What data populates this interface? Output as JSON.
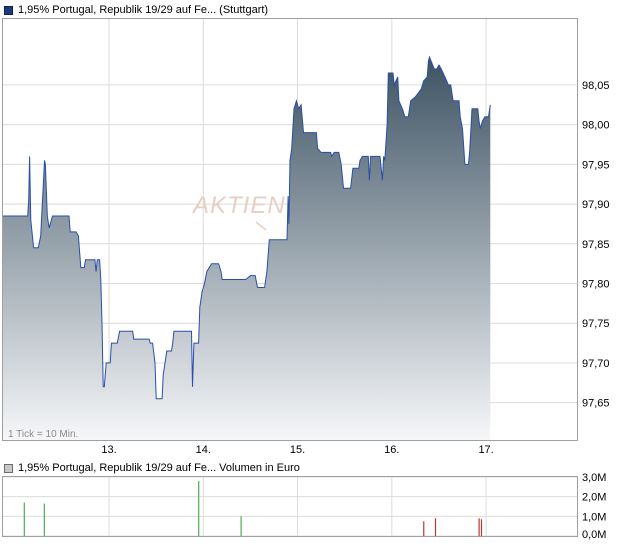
{
  "price_legend": {
    "label": "1,95% Portugal, Republik 19/29 auf Fe... (Stuttgart)"
  },
  "volume_legend": {
    "label": "1,95% Portugal, Republik 19/29 auf Fe... Volumen in Euro"
  },
  "tick_note": "1 Tick = 10 Min.",
  "watermark": "AKTIEN",
  "colors": {
    "line": "#2a4fa8",
    "area_top": "#3d5363",
    "area_bottom": "#f6f7f9",
    "grid": "#dcdcdc",
    "frame": "#a0a0a0",
    "volume_up": "#4caf50",
    "volume_down": "#c0392b"
  },
  "chart_data": [
    {
      "type": "area",
      "name": "price",
      "x_ticks": [
        {
          "label": "13.",
          "x": 4.5
        },
        {
          "label": "14.",
          "x": 8.5
        },
        {
          "label": "15.",
          "x": 12.5
        },
        {
          "label": "16.",
          "x": 16.5
        },
        {
          "label": "17.",
          "x": 20.5
        }
      ],
      "xlim": [
        0,
        24.4
      ],
      "ylim": [
        97.603,
        98.133
      ],
      "y_ticks": [
        {
          "label": "97,65",
          "value": 97.65
        },
        {
          "label": "97,70",
          "value": 97.7
        },
        {
          "label": "97,75",
          "value": 97.75
        },
        {
          "label": "97,80",
          "value": 97.8
        },
        {
          "label": "97,85",
          "value": 97.85
        },
        {
          "label": "97,90",
          "value": 97.9
        },
        {
          "label": "97,95",
          "value": 97.95
        },
        {
          "label": "98,00",
          "value": 98.0
        },
        {
          "label": "98,05",
          "value": 98.05
        }
      ],
      "points": [
        [
          0.0,
          97.885
        ],
        [
          1.05,
          97.885
        ],
        [
          1.09,
          97.905
        ],
        [
          1.13,
          97.96
        ],
        [
          1.18,
          97.88
        ],
        [
          1.3,
          97.845
        ],
        [
          1.5,
          97.845
        ],
        [
          1.6,
          97.86
        ],
        [
          1.76,
          97.955
        ],
        [
          1.8,
          97.95
        ],
        [
          1.88,
          97.885
        ],
        [
          1.96,
          97.87
        ],
        [
          2.1,
          97.885
        ],
        [
          2.8,
          97.885
        ],
        [
          2.85,
          97.865
        ],
        [
          3.1,
          97.865
        ],
        [
          3.2,
          97.86
        ],
        [
          3.3,
          97.82
        ],
        [
          3.45,
          97.82
        ],
        [
          3.5,
          97.83
        ],
        [
          3.9,
          97.83
        ],
        [
          3.95,
          97.815
        ],
        [
          4.0,
          97.83
        ],
        [
          4.1,
          97.83
        ],
        [
          4.15,
          97.805
        ],
        [
          4.2,
          97.75
        ],
        [
          4.25,
          97.67
        ],
        [
          4.3,
          97.67
        ],
        [
          4.38,
          97.7
        ],
        [
          4.55,
          97.7
        ],
        [
          4.6,
          97.725
        ],
        [
          4.85,
          97.725
        ],
        [
          4.95,
          97.74
        ],
        [
          5.5,
          97.74
        ],
        [
          5.55,
          97.73
        ],
        [
          6.2,
          97.73
        ],
        [
          6.25,
          97.725
        ],
        [
          6.35,
          97.725
        ],
        [
          6.45,
          97.7
        ],
        [
          6.5,
          97.655
        ],
        [
          6.75,
          97.655
        ],
        [
          6.8,
          97.685
        ],
        [
          6.95,
          97.715
        ],
        [
          7.15,
          97.715
        ],
        [
          7.2,
          97.725
        ],
        [
          7.25,
          97.74
        ],
        [
          8.0,
          97.74
        ],
        [
          8.04,
          97.67
        ],
        [
          8.1,
          97.725
        ],
        [
          8.3,
          97.725
        ],
        [
          8.35,
          97.77
        ],
        [
          8.45,
          97.79
        ],
        [
          8.55,
          97.8
        ],
        [
          8.65,
          97.815
        ],
        [
          8.75,
          97.82
        ],
        [
          8.85,
          97.825
        ],
        [
          9.15,
          97.825
        ],
        [
          9.25,
          97.815
        ],
        [
          9.3,
          97.805
        ],
        [
          9.6,
          97.805
        ],
        [
          9.95,
          97.805
        ],
        [
          10.3,
          97.805
        ],
        [
          10.5,
          97.81
        ],
        [
          10.7,
          97.81
        ],
        [
          10.8,
          97.795
        ],
        [
          11.1,
          97.795
        ],
        [
          11.2,
          97.815
        ],
        [
          11.3,
          97.855
        ],
        [
          12.05,
          97.855
        ],
        [
          12.1,
          97.91
        ],
        [
          12.13,
          97.875
        ],
        [
          12.18,
          97.955
        ],
        [
          12.25,
          97.97
        ],
        [
          12.35,
          98.02
        ],
        [
          12.45,
          98.03
        ],
        [
          12.55,
          98.02
        ],
        [
          12.65,
          98.025
        ],
        [
          12.75,
          97.99
        ],
        [
          13.3,
          97.99
        ],
        [
          13.35,
          97.97
        ],
        [
          13.5,
          97.965
        ],
        [
          13.9,
          97.965
        ],
        [
          13.95,
          97.96
        ],
        [
          14.05,
          97.965
        ],
        [
          14.25,
          97.965
        ],
        [
          14.35,
          97.95
        ],
        [
          14.45,
          97.92
        ],
        [
          14.75,
          97.92
        ],
        [
          14.85,
          97.945
        ],
        [
          15.1,
          97.945
        ],
        [
          15.15,
          97.955
        ],
        [
          15.25,
          97.96
        ],
        [
          15.5,
          97.96
        ],
        [
          15.55,
          97.93
        ],
        [
          15.6,
          97.96
        ],
        [
          16.0,
          97.96
        ],
        [
          16.05,
          97.945
        ],
        [
          16.1,
          97.93
        ],
        [
          16.15,
          97.96
        ],
        [
          16.2,
          97.955
        ],
        [
          16.3,
          98.0
        ],
        [
          16.35,
          98.065
        ],
        [
          16.55,
          98.065
        ],
        [
          16.6,
          98.05
        ],
        [
          16.75,
          98.06
        ],
        [
          16.8,
          98.03
        ],
        [
          16.95,
          98.02
        ],
        [
          17.05,
          98.01
        ],
        [
          17.2,
          98.01
        ],
        [
          17.3,
          98.03
        ],
        [
          17.5,
          98.035
        ],
        [
          17.75,
          98.045
        ],
        [
          17.85,
          98.055
        ],
        [
          18.0,
          98.06
        ],
        [
          18.05,
          98.08
        ],
        [
          18.1,
          98.085
        ],
        [
          18.3,
          98.07
        ],
        [
          18.4,
          98.07
        ],
        [
          18.5,
          98.075
        ],
        [
          18.6,
          98.07
        ],
        [
          18.75,
          98.06
        ],
        [
          18.9,
          98.05
        ],
        [
          19.0,
          98.05
        ],
        [
          19.05,
          98.04
        ],
        [
          19.1,
          98.03
        ],
        [
          19.35,
          98.03
        ],
        [
          19.4,
          98.01
        ],
        [
          19.5,
          97.995
        ],
        [
          19.6,
          97.95
        ],
        [
          19.75,
          97.95
        ],
        [
          19.8,
          97.965
        ],
        [
          19.9,
          98.02
        ],
        [
          20.15,
          98.02
        ],
        [
          20.2,
          98.005
        ],
        [
          20.25,
          97.995
        ],
        [
          20.35,
          98.005
        ],
        [
          20.45,
          98.01
        ],
        [
          20.6,
          98.01
        ],
        [
          20.68,
          98.025
        ]
      ]
    },
    {
      "type": "bar",
      "name": "volume",
      "ylim": [
        0,
        3.0
      ],
      "y_ticks": [
        {
          "label": "0,0M",
          "value": 0.0
        },
        {
          "label": "1,0M",
          "value": 1.0
        },
        {
          "label": "2,0M",
          "value": 2.0
        },
        {
          "label": "3,0M",
          "value": 3.0
        }
      ],
      "bars": [
        {
          "x": 0.9,
          "value": 1.7,
          "dir": "up"
        },
        {
          "x": 1.75,
          "value": 1.65,
          "dir": "up"
        },
        {
          "x": 8.3,
          "value": 2.8,
          "dir": "up"
        },
        {
          "x": 10.1,
          "value": 1.0,
          "dir": "up"
        },
        {
          "x": 17.85,
          "value": 0.75,
          "dir": "down"
        },
        {
          "x": 18.35,
          "value": 0.9,
          "dir": "down"
        },
        {
          "x": 20.2,
          "value": 0.9,
          "dir": "down"
        },
        {
          "x": 20.3,
          "value": 0.85,
          "dir": "down"
        }
      ]
    }
  ]
}
